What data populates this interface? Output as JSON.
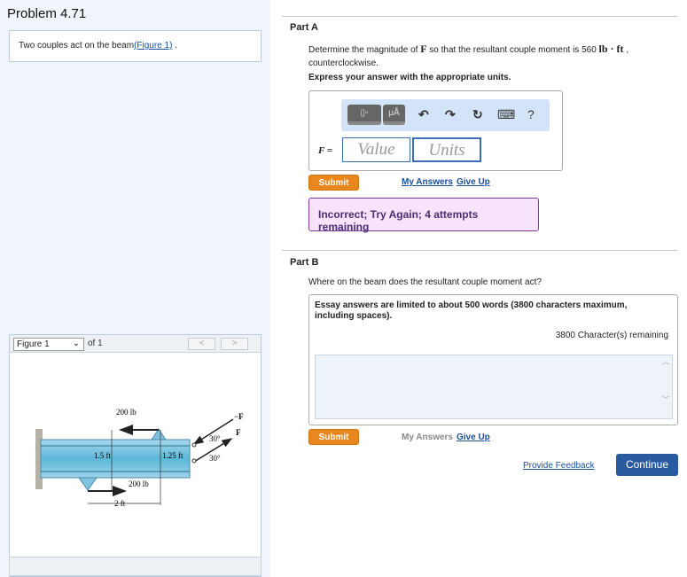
{
  "problem": {
    "title": "Problem 4.71",
    "description": "Two couples act on the beam",
    "figure_link": "(Figure 1)",
    "desc_end": "."
  },
  "figure": {
    "selector": "Figure 1",
    "of": "of 1",
    "prev": "<",
    "next": ">",
    "labels": {
      "force_top": "200 lb",
      "force_bottom": "200 lb",
      "neg_f": "−F",
      "f": "F",
      "h1": "1.5 ft",
      "h2": "1.25 ft",
      "angle1": "30°",
      "angle2": "30°",
      "dist": "2 ft"
    }
  },
  "partA": {
    "label": "Part A",
    "question_pre": "Determine the magnitude of ",
    "question_var": "F",
    "question_mid": " so that the resultant couple moment is 560 ",
    "question_unit": "lb · ft",
    "question_post": " , counterclockwise.",
    "instruction": "Express your answer with the appropriate units.",
    "toolbar": {
      "templates": "▯▫",
      "units": "μÅ",
      "undo": "↶",
      "redo": "↷",
      "reset": "↻",
      "keyboard": "⌨",
      "help": "?"
    },
    "var_label": "F =",
    "value_placeholder": "Value",
    "units_placeholder": "Units",
    "submit": "Submit",
    "my_answers": "My Answers",
    "give_up": "Give Up",
    "feedback": "Incorrect; Try Again; 4 attempts remaining"
  },
  "partB": {
    "label": "Part B",
    "question": "Where on the beam does the resultant couple moment act?",
    "essay_note": "Essay answers are limited to about 500 words (3800 characters maximum, including spaces).",
    "remaining": "3800 Character(s) remaining",
    "submit": "Submit",
    "my_answers": "My Answers",
    "give_up": "Give Up"
  },
  "footer": {
    "provide_feedback": "Provide Feedback",
    "continue": "Continue"
  }
}
